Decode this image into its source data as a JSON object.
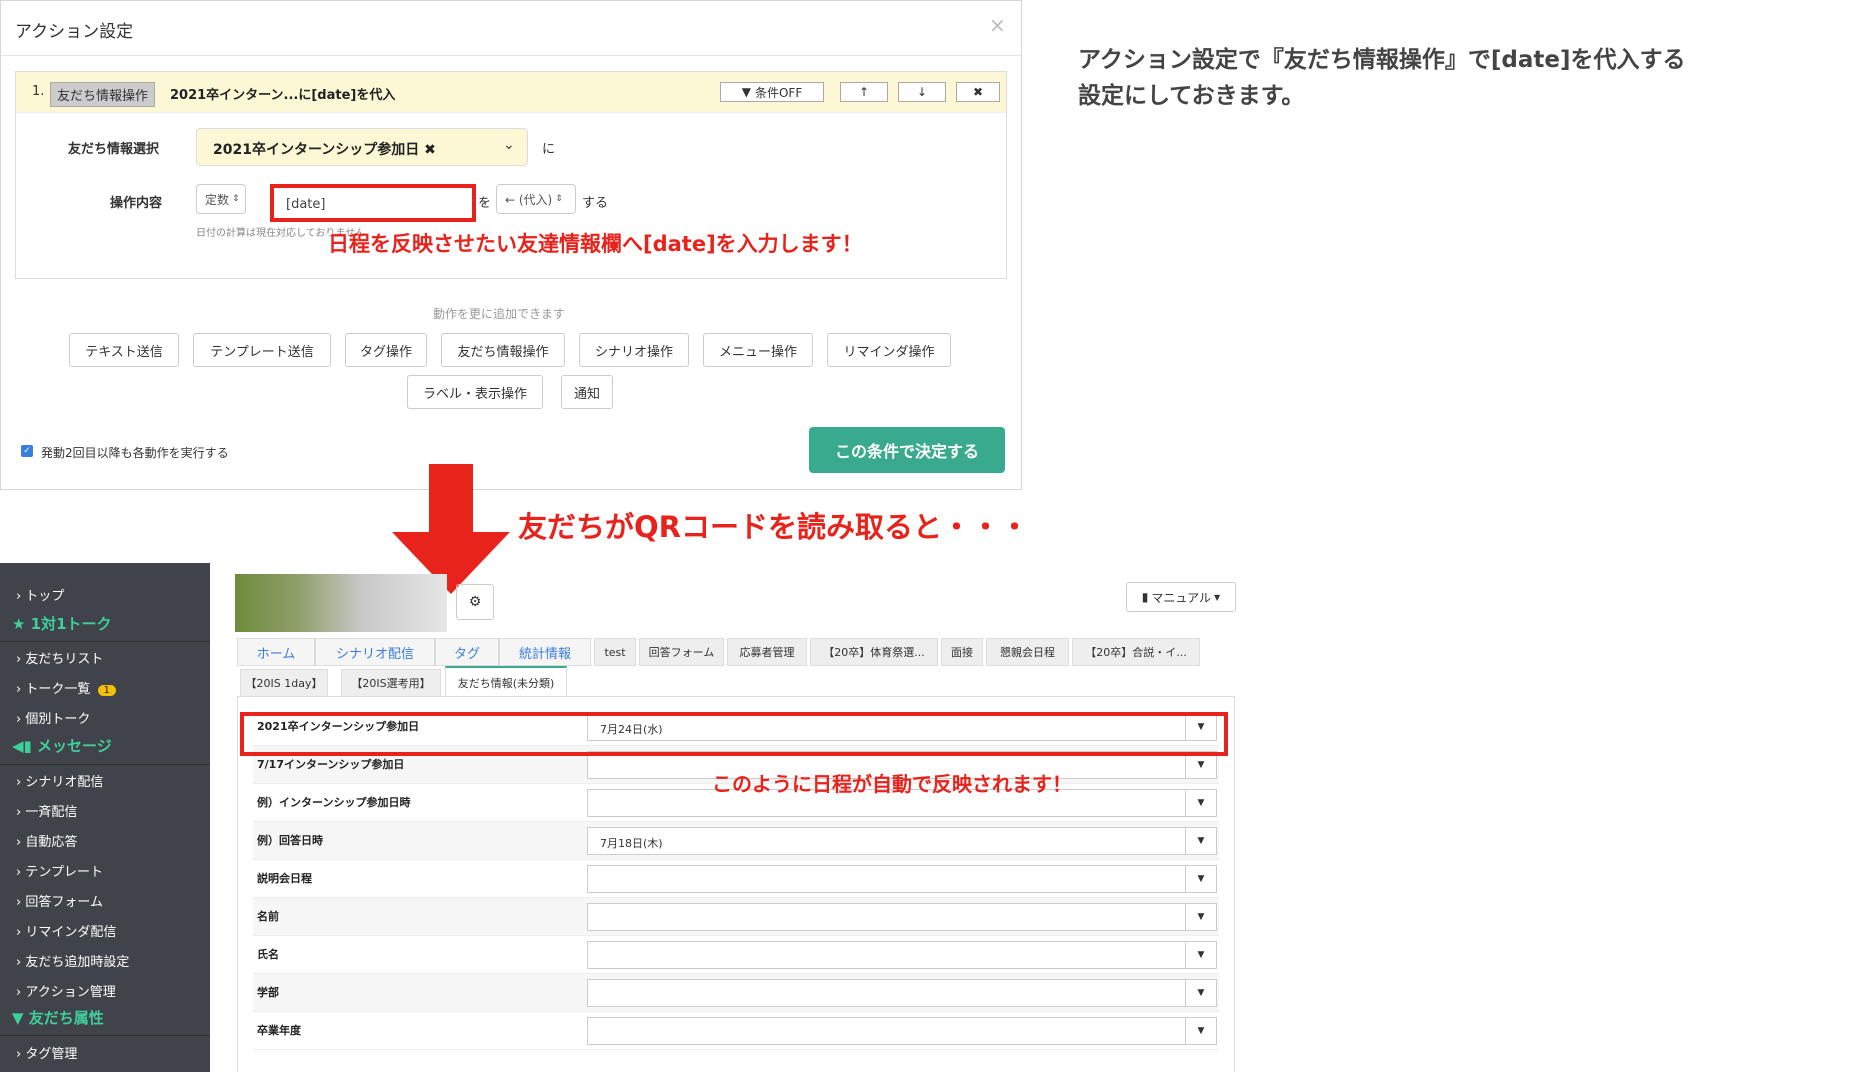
{
  "modal": {
    "title": "アクション設定",
    "close": "×",
    "action": {
      "number": "1.",
      "tag": "友だち情報操作",
      "title": "2021卒インターン...に[date]を代入",
      "cond_off": "条件OFF",
      "up": "↑",
      "down": "↓",
      "remove": "✖"
    },
    "friend_info_label": "友だち情報選択",
    "friend_info_value": "2021卒インターンシップ参加日 ✖",
    "ni": "に",
    "op_label": "操作内容",
    "op_type": "定数",
    "op_value": "[date]",
    "wo": "を",
    "op_mode": "← (代入)",
    "suru": "する",
    "date_note": "日付の計算は現在対応しておりません",
    "add_more": "動作を更に追加できます",
    "buttons": [
      "テキスト送信",
      "テンプレート送信",
      "タグ操作",
      "友だち情報操作",
      "シナリオ操作",
      "メニュー操作",
      "リマインダ操作",
      "ラベル・表示操作",
      "通知"
    ],
    "checkbox_label": "発動2回目以降も各動作を実行する",
    "confirm": "この条件で決定する"
  },
  "annotations": {
    "top_note": "アクション設定で『友だち情報操作』で[date]を代入する\n設定にしておきます。",
    "input_note": "日程を反映させたい友達情報欄へ[date]を入力します！",
    "qr_note": "友だちがQRコードを読み取ると・・・",
    "reflect_note": "このように日程が自動で反映されます！"
  },
  "colors": {
    "annotation_red": "#e8231c",
    "confirm_green": "#3aaa8e",
    "sidebar_bg": "#40434a",
    "sidebar_head": "#3fcf9b",
    "link_blue": "#3b7ddd"
  },
  "sidebar": {
    "top": "トップ",
    "section1": "★ 1対1トーク",
    "items1": [
      "友だちリスト",
      "トーク一覧",
      "個別トーク"
    ],
    "badge": "1",
    "section2": "メッセージ",
    "items2": [
      "シナリオ配信",
      "一斉配信",
      "自動応答",
      "テンプレート",
      "回答フォーム",
      "リマインダ配信",
      "友だち追加時設定",
      "アクション管理"
    ],
    "section3": "友だち属性",
    "items3": [
      "タグ管理"
    ]
  },
  "main": {
    "manual": "マニュアル",
    "gear": "⚙",
    "tabs_row1": [
      "ホーム",
      "シナリオ配信",
      "タグ",
      "統計情報",
      "test",
      "回答フォーム",
      "応募者管理",
      "【20卒】体育祭選...",
      "面接",
      "懇親会日程",
      "【20卒】合説・イ..."
    ],
    "tabs_row2": [
      "【20IS 1day】",
      "【20IS選考用】",
      "友だち情報(未分類)"
    ],
    "fields": [
      {
        "label": "2021卒インターンシップ参加日",
        "value": "7月24日(水)"
      },
      {
        "label": "7/17インターンシップ参加日",
        "value": ""
      },
      {
        "label": "例）インターンシップ参加日時",
        "value": ""
      },
      {
        "label": "例）回答日時",
        "value": "7月18日(木)"
      },
      {
        "label": "説明会日程",
        "value": ""
      },
      {
        "label": "名前",
        "value": ""
      },
      {
        "label": "氏名",
        "value": ""
      },
      {
        "label": "学部",
        "value": ""
      },
      {
        "label": "卒業年度",
        "value": ""
      }
    ]
  }
}
